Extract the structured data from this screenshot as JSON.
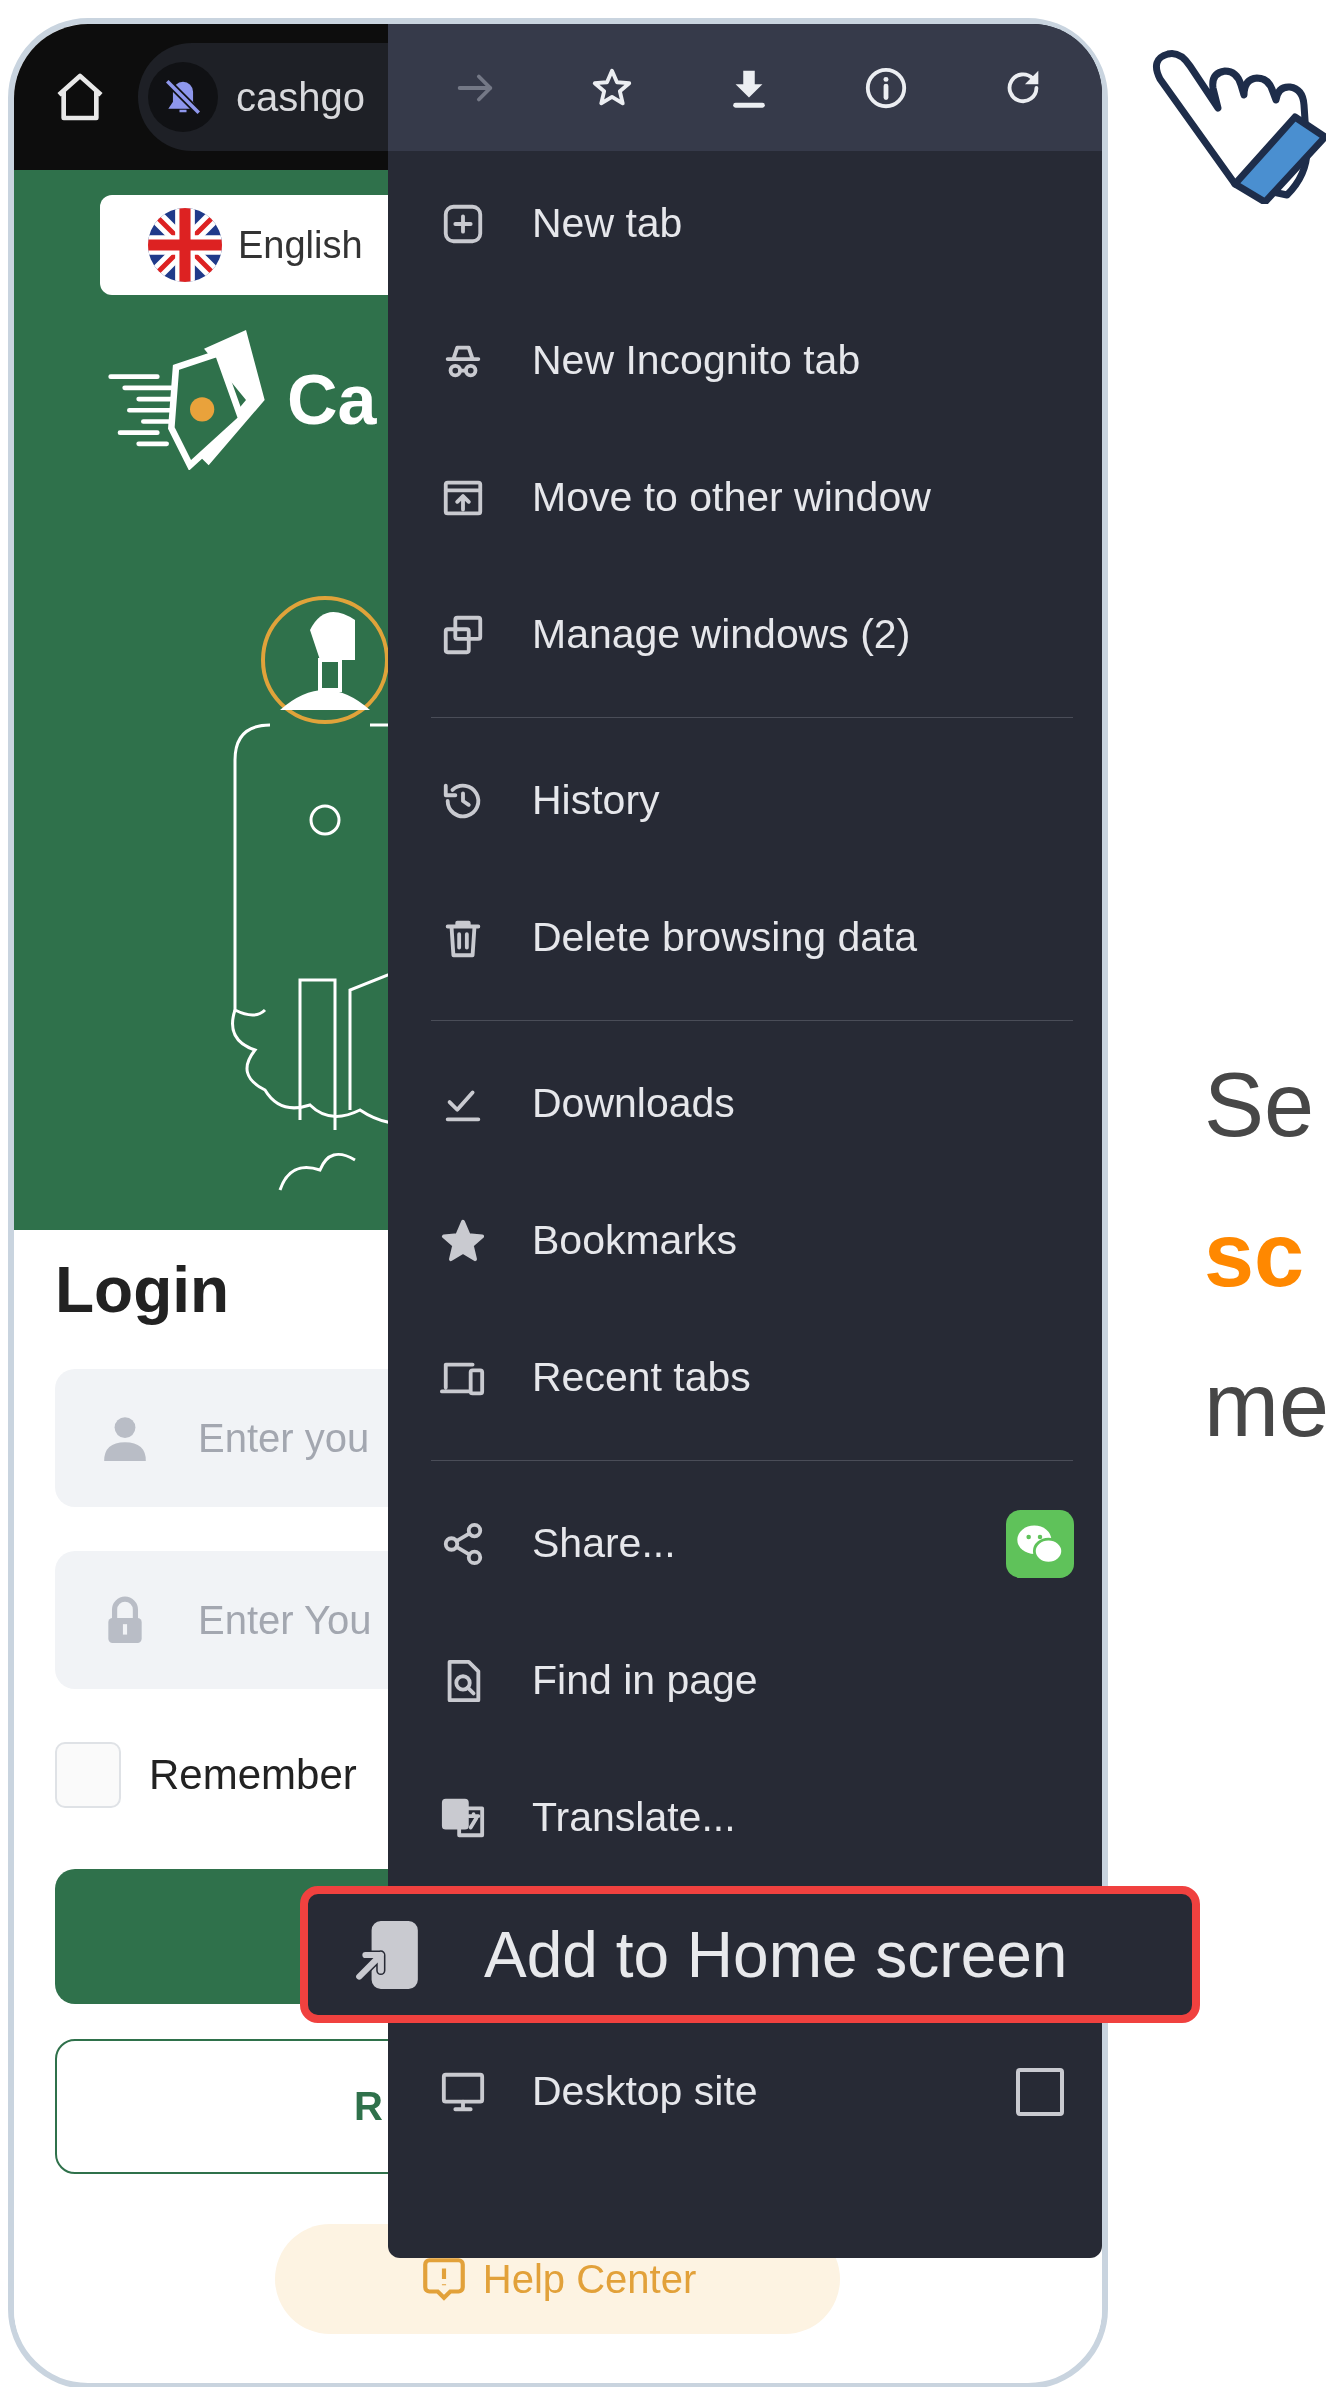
{
  "browser": {
    "url": "cashgo"
  },
  "page": {
    "language": "English",
    "logo_text": "Ca",
    "title": "Login",
    "fields": [
      {
        "kind": "user",
        "placeholder": "Enter you"
      },
      {
        "kind": "password",
        "placeholder": "Enter You"
      }
    ],
    "remember": {
      "label": "Remember",
      "checked": false
    },
    "register_button": "R",
    "help": "Help Center"
  },
  "menu": {
    "toolbar": [
      {
        "kind": "forward",
        "disabled": true
      },
      {
        "kind": "star",
        "disabled": false
      },
      {
        "kind": "download",
        "disabled": false
      },
      {
        "kind": "info",
        "disabled": false
      },
      {
        "kind": "refresh",
        "disabled": false
      }
    ],
    "groups": [
      [
        {
          "kind": "new-tab",
          "label": "New tab",
          "highlighted": false
        },
        {
          "kind": "incognito",
          "label": "New Incognito tab",
          "highlighted": false
        },
        {
          "kind": "move-window",
          "label": "Move to other window",
          "highlighted": false
        },
        {
          "kind": "windows",
          "label": "Manage windows (2)",
          "highlighted": false
        }
      ],
      [
        {
          "kind": "history",
          "label": "History",
          "highlighted": false
        },
        {
          "kind": "delete",
          "label": "Delete browsing data",
          "highlighted": false
        }
      ],
      [
        {
          "kind": "downloads",
          "label": "Downloads",
          "highlighted": false
        },
        {
          "kind": "bookmarks",
          "label": "Bookmarks",
          "highlighted": false
        },
        {
          "kind": "devices",
          "label": "Recent tabs",
          "highlighted": false
        }
      ],
      [
        {
          "kind": "share",
          "label": "Share...",
          "highlighted": false,
          "accessory": {
            "kind": "app-badge"
          }
        },
        {
          "kind": "find",
          "label": "Find in page",
          "highlighted": false
        },
        {
          "kind": "translate",
          "label": "Translate...",
          "highlighted": false
        },
        {
          "kind": "add-home",
          "label": "Add to Home screen",
          "highlighted": true
        },
        {
          "kind": "desktop",
          "label": "Desktop site",
          "highlighted": false,
          "accessory": {
            "kind": "checkbox",
            "checked": false
          }
        }
      ]
    ]
  },
  "caption": [
    {
      "text": "Se",
      "highlight": false
    },
    {
      "text": "sc",
      "highlight": true
    },
    {
      "text": "me",
      "highlight": false
    }
  ]
}
